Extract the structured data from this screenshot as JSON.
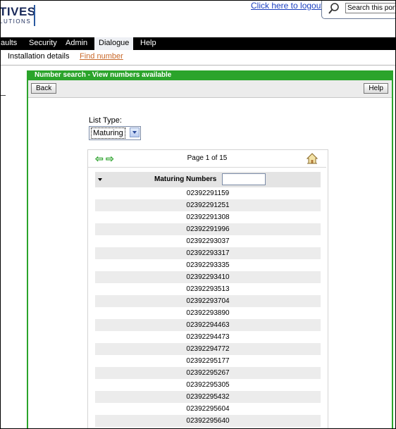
{
  "brand": {
    "main": "TIVES",
    "sub": "LUTIONS"
  },
  "header": {
    "logout_link": "Click here to logout",
    "search_placeholder": "Search this portal"
  },
  "nav": {
    "items": [
      "aults",
      "Security",
      "Admin",
      "Dialogue",
      "Help"
    ],
    "active": "Dialogue"
  },
  "subnav": {
    "items": [
      "Installation details",
      "Find number"
    ]
  },
  "panel": {
    "title": "Number search - View numbers available",
    "back_button": "Back",
    "help_button": "Help"
  },
  "list_type": {
    "label": "List Type:",
    "selected": "Maturing"
  },
  "pager": {
    "text": "Page 1 of 15"
  },
  "table": {
    "column_header": "Maturing Numbers",
    "filter_value": "",
    "rows": [
      "02392291159",
      "02392291251",
      "02392291308",
      "02392291996",
      "02392293037",
      "02392293317",
      "02392293335",
      "02392293410",
      "02392293513",
      "02392293704",
      "02392293890",
      "02392294463",
      "02392294473",
      "02392294772",
      "02392295177",
      "02392295267",
      "02392295305",
      "02392295432",
      "02392295604",
      "02392295640"
    ]
  },
  "colors": {
    "accent_green": "#2ba42b",
    "nav_bg": "#000000",
    "link_blue": "#1a3fc0",
    "link_orange": "#c9692a"
  },
  "icons": [
    "search-icon",
    "back-arrow-icon",
    "forward-arrow-icon",
    "home-icon",
    "chevron-down-icon"
  ]
}
